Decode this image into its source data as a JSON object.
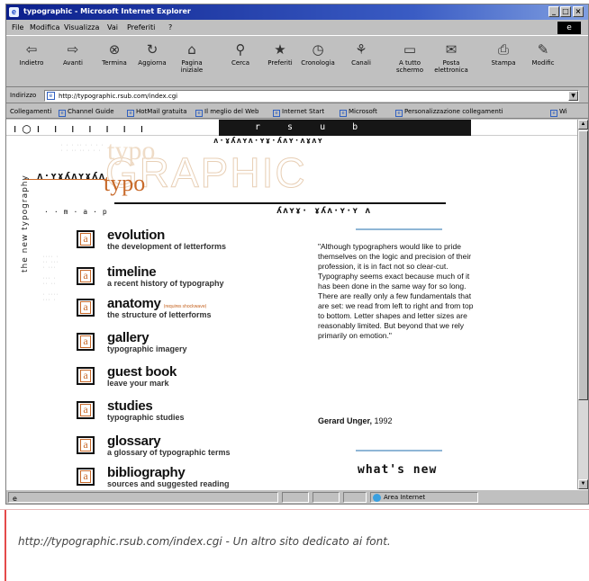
{
  "window": {
    "title": "typographic - Microsoft Internet Explorer",
    "controls": [
      "_",
      "□",
      "×"
    ]
  },
  "menubar": [
    "File",
    "Modifica",
    "Visualizza",
    "Vai",
    "Preferiti",
    "?"
  ],
  "toolbar": [
    {
      "label": "Indietro",
      "icon": "back-arrow-icon",
      "glyph": "⇦"
    },
    {
      "label": "Avanti",
      "icon": "forward-arrow-icon",
      "glyph": "⇨"
    },
    {
      "label": "Termina",
      "icon": "stop-icon",
      "glyph": "⊗"
    },
    {
      "label": "Aggiorna",
      "icon": "refresh-icon",
      "glyph": "↻"
    },
    {
      "label": "Pagina iniziale",
      "icon": "home-icon",
      "glyph": "⌂"
    },
    {
      "label": "Cerca",
      "icon": "search-icon",
      "glyph": "⚲"
    },
    {
      "label": "Preferiti",
      "icon": "favorites-icon",
      "glyph": "★"
    },
    {
      "label": "Cronologia",
      "icon": "history-icon",
      "glyph": "◷"
    },
    {
      "label": "Canali",
      "icon": "channels-icon",
      "glyph": "⚘"
    },
    {
      "label": "A tutto schermo",
      "icon": "fullscreen-icon",
      "glyph": "▭"
    },
    {
      "label": "Posta elettronica",
      "icon": "mail-icon",
      "glyph": "✉"
    },
    {
      "label": "Stampa",
      "icon": "print-icon",
      "glyph": "⎙"
    },
    {
      "label": "Modific",
      "icon": "edit-icon",
      "glyph": "✎"
    }
  ],
  "address": {
    "label": "Indirizzo",
    "value": "http://typographic.rsub.com/index.cgi"
  },
  "links": {
    "label": "Collegamenti",
    "items": [
      "Channel Guide",
      "HotMail gratuita",
      "Il meglio del Web",
      "Internet Start",
      "Microsoft",
      "Personalizzazione collegamenti",
      "Wi"
    ]
  },
  "site": {
    "header_letters": "r s u b",
    "vertical_tagline": "the new typography",
    "logo_big": "GRAPHIC",
    "logo_small": "typo",
    "nav": [
      {
        "title": "evolution",
        "subtitle": "the development of letterforms",
        "tiny": ""
      },
      {
        "title": "timeline",
        "subtitle": "a recent history of typography",
        "tiny": ""
      },
      {
        "title": "anatomy",
        "subtitle": "the structure of letterforms",
        "tiny": "(requires shockwave)"
      },
      {
        "title": "gallery",
        "subtitle": "typographic imagery",
        "tiny": ""
      },
      {
        "title": "guest book",
        "subtitle": "leave your mark",
        "tiny": ""
      },
      {
        "title": "studies",
        "subtitle": "typographic studies",
        "tiny": ""
      },
      {
        "title": "glossary",
        "subtitle": "a glossary of typographic terms",
        "tiny": ""
      },
      {
        "title": "bibliography",
        "subtitle": "sources and suggested reading",
        "tiny": ""
      }
    ],
    "quote": "\"Although typographers would like to pride themselves on the logic and precision of their profession, it is in fact not so clear-cut. Typography seems exact because much of it has been done in the same way for so long. There are really only a few fundamentals that are set: we read from left to right and from top to bottom. Letter shapes and letter sizes are reasonably limited. But beyond that we rely primarily on emotion.\"",
    "quote_author": "Gerard Unger,",
    "quote_year": " 1992",
    "whats_new": "what's new"
  },
  "statusbar": {
    "zone": "Area Internet"
  },
  "caption": "http://typographic.rsub.com/index.cgi - Un altro sito dedicato ai font."
}
